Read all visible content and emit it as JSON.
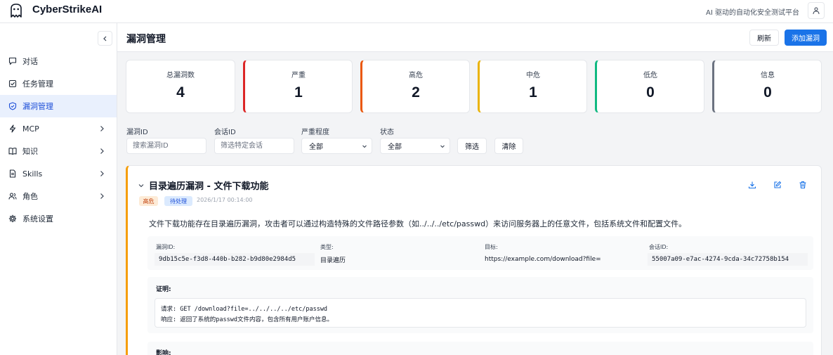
{
  "app": {
    "title": "CyberStrikeAI",
    "tagline": "AI 驱动的自动化安全测试平台"
  },
  "sidebar": {
    "items": [
      {
        "label": "对话",
        "icon": "chat-icon",
        "has_submenu": false,
        "active": false
      },
      {
        "label": "任务管理",
        "icon": "checkbox-icon",
        "has_submenu": false,
        "active": false
      },
      {
        "label": "漏洞管理",
        "icon": "shield-icon",
        "has_submenu": false,
        "active": true
      },
      {
        "label": "MCP",
        "icon": "lightning-icon",
        "has_submenu": true,
        "active": false
      },
      {
        "label": "知识",
        "icon": "book-icon",
        "has_submenu": true,
        "active": false
      },
      {
        "label": "Skills",
        "icon": "document-icon",
        "has_submenu": true,
        "active": false
      },
      {
        "label": "角色",
        "icon": "users-icon",
        "has_submenu": true,
        "active": false
      },
      {
        "label": "系统设置",
        "icon": "gear-icon",
        "has_submenu": false,
        "active": false
      }
    ]
  },
  "header": {
    "title": "漏洞管理",
    "refresh_label": "刷新",
    "add_label": "添加漏洞"
  },
  "stats": [
    {
      "label": "总漏洞数",
      "value": "4",
      "color": ""
    },
    {
      "label": "严重",
      "value": "1",
      "color": "#dc2626"
    },
    {
      "label": "高危",
      "value": "2",
      "color": "#ea580c"
    },
    {
      "label": "中危",
      "value": "1",
      "color": "#eab308"
    },
    {
      "label": "低危",
      "value": "0",
      "color": "#10b981"
    },
    {
      "label": "信息",
      "value": "0",
      "color": "#6b7280"
    }
  ],
  "filters": {
    "vuln_id_label": "漏洞ID",
    "vuln_id_placeholder": "搜索漏洞ID",
    "session_id_label": "会话ID",
    "session_id_placeholder": "筛选特定会话",
    "severity_label": "严重程度",
    "severity_value": "全部",
    "status_label": "状态",
    "status_value": "全部",
    "filter_button": "筛选",
    "clear_button": "清除"
  },
  "vulnerability": {
    "title": "目录遍历漏洞 - 文件下载功能",
    "severity": "高危",
    "status": "待处理",
    "time": "2026/1/17 00:14:00",
    "description": "文件下载功能存在目录遍历漏洞，攻击者可以通过构造特殊的文件路径参数（如../../../etc/passwd）来访问服务器上的任意文件，包括系统文件和配置文件。",
    "meta": {
      "id_label": "漏洞ID:",
      "id_value": "9db15c5e-f3d8-440b-b282-b9d80e2984d5",
      "type_label": "类型:",
      "type_value": "目录遍历",
      "target_label": "目标:",
      "target_value": "https://example.com/download?file=",
      "session_label": "会话ID:",
      "session_value": "55007a09-e7ac-4274-9cda-34c72758b154"
    },
    "proof_label": "证明:",
    "proof_request": "请求: GET /download?file=../../../../etc/passwd",
    "proof_response": "响应: 返回了系统的passwd文件内容，包含所有用户账户信息。",
    "impact_label": "影响:"
  },
  "colors": {
    "accent": "#1a73e8",
    "card_border_high": "#f59e0b"
  }
}
